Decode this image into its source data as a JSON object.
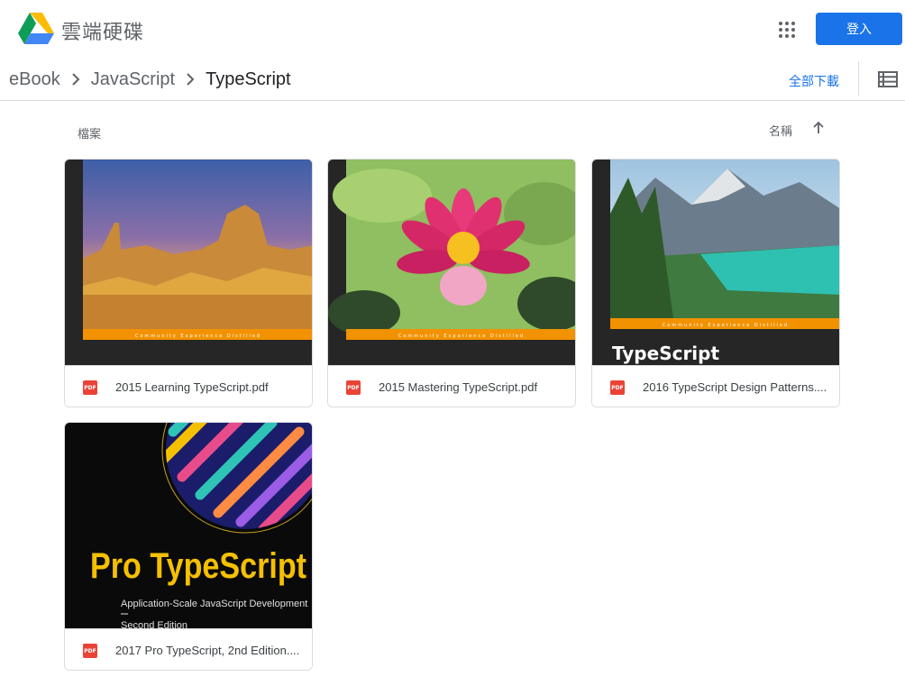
{
  "app": {
    "title": "雲端硬碟",
    "signin_label": "登入",
    "accent": "#1a73e8"
  },
  "breadcrumb": {
    "items": [
      {
        "label": "eBook"
      },
      {
        "label": "JavaScript"
      },
      {
        "label": "TypeScript"
      }
    ]
  },
  "toolbar": {
    "download_all_label": "全部下載"
  },
  "section": {
    "label": "檔案",
    "sort_label": "名稱",
    "sort_direction": "ascending"
  },
  "files": [
    {
      "name": "2015 Learning TypeScript.pdf",
      "type_badge": "PDF",
      "icon": "pdf-icon",
      "thumb_caption": "Community Experience Distilled"
    },
    {
      "name": "2015 Mastering TypeScript.pdf",
      "type_badge": "PDF",
      "icon": "pdf-icon",
      "thumb_caption": "Community Experience Distilled"
    },
    {
      "name": "2016 TypeScript Design Patterns....",
      "type_badge": "PDF",
      "icon": "pdf-icon",
      "thumb_caption": "Community Experience Distilled",
      "thumb_title": "TypeScript"
    },
    {
      "name": "2017 Pro TypeScript, 2nd Edition....",
      "type_badge": "PDF",
      "icon": "pdf-icon",
      "thumb_title": "Pro TypeScript",
      "thumb_subtitle": "Application-Scale JavaScript Development",
      "thumb_edition": "Second Edition"
    }
  ]
}
